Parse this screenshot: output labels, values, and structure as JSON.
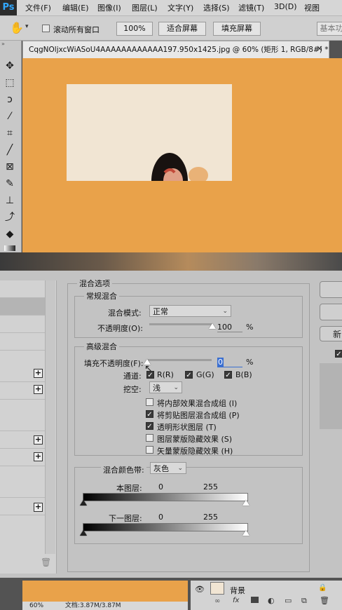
{
  "app": {
    "logo": "Ps"
  },
  "menu": [
    "文件(F)",
    "编辑(E)",
    "图像(I)",
    "图层(L)",
    "文字(Y)",
    "选择(S)",
    "滤镜(T)",
    "3D(D)",
    "视图"
  ],
  "options_bar": {
    "scroll_all_label": "滚动所有窗口",
    "zoom_100": "100%",
    "fit_screen": "适合屏幕",
    "fill_screen": "填充屏幕",
    "workspace": "基本功"
  },
  "doc_tab": {
    "title": "CqgNOljxcWiASoU4AAAAAAAAAAAA197.950x1425.jpg @ 60% (矩形 1, RGB/8#) *",
    "close": "×"
  },
  "dialog": {
    "blend_options_title": "混合选项",
    "general_blending": {
      "title": "常规混合",
      "blend_mode_label": "混合模式:",
      "blend_mode_value": "正常",
      "opacity_label": "不透明度(O):",
      "opacity_value": "100",
      "opacity_unit": "%",
      "opacity_level": 1.0
    },
    "advanced_blending": {
      "title": "高级混合",
      "fill_opacity_label": "填充不透明度(F):",
      "fill_opacity_value": "0",
      "fill_opacity_unit": "%",
      "fill_opacity_level": 0,
      "channels_label": "通道:",
      "channels": [
        {
          "label": "R(R)",
          "checked": true
        },
        {
          "label": "G(G)",
          "checked": true
        },
        {
          "label": "B(B)",
          "checked": true
        }
      ],
      "knockout_label": "挖空:",
      "knockout_value": "浅",
      "options": [
        {
          "label": "将内部效果混合成组 (I)",
          "checked": false
        },
        {
          "label": "将剪贴图层混合成组 (P)",
          "checked": true
        },
        {
          "label": "透明形状图层 (T)",
          "checked": true
        },
        {
          "label": "图层蒙版隐藏效果 (S)",
          "checked": false
        },
        {
          "label": "矢量蒙版隐藏效果 (H)",
          "checked": false
        }
      ]
    },
    "blend_if": {
      "label": "混合颜色带:",
      "value": "灰色",
      "this_layer_label": "本图层:",
      "this_layer_min": "0",
      "this_layer_max": "255",
      "underlying_label": "下一图层:",
      "underlying_min": "0",
      "underlying_max": "255"
    },
    "right_buttons": [
      "",
      "",
      "新"
    ]
  },
  "layers_panel": {
    "layer_name": "背景",
    "icons": [
      "link-icon",
      "fx-icon",
      "mask-icon",
      "adjustment-icon",
      "folder-icon",
      "new-layer-icon",
      "trash-icon"
    ]
  },
  "status_bar": {
    "zoom": "60%",
    "doc_info": "文档:3.87M/3.87M"
  },
  "colors": {
    "canvas_orange": "#e9a24a",
    "dialog_bg": "#c3c3c3",
    "photo_bg": "#f1e5d3"
  }
}
